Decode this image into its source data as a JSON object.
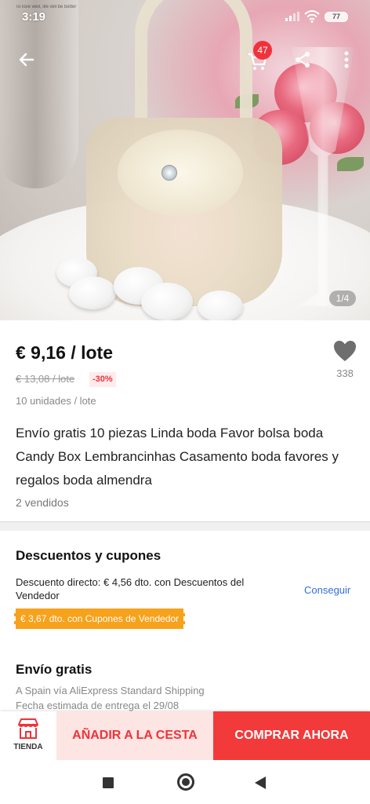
{
  "statusbar": {
    "brand": "To love well, life will be better",
    "time": "3:19",
    "battery": "77"
  },
  "topbar": {
    "back_icon": "arrow-left-icon",
    "cart_icon": "cart-icon",
    "cart_count": "47",
    "share_icon": "share-icon",
    "more_icon": "more-vertical-icon"
  },
  "gallery": {
    "counter": "1/4"
  },
  "product": {
    "price": "€ 9,16 / lote",
    "old_price": "€ 13,08 / lote",
    "discount": "-30%",
    "units": "10 unidades / lote",
    "title": "Envío gratis 10 piezas Linda boda Favor bolsa boda Candy Box Lembrancinhas Casamento boda favores y regalos boda almendra",
    "sold": "2 vendidos",
    "wishlist_count": "338"
  },
  "coupons": {
    "title": "Descuentos y cupones",
    "direct_discount": "Descuento directo: € 4,56 dto. con Descuentos del Vendedor",
    "get_label": "Conseguir",
    "seller_coupon": "€ 3,67 dto. con Cupones de Vendedor"
  },
  "shipping": {
    "title": "Envío gratis",
    "route": "A Spain vía AliExpress Standard Shipping",
    "estimate": "Fecha estimada de entrega el 29/08"
  },
  "actions": {
    "store_label": "TIENDA",
    "add_to_cart": "AÑADIR A LA CESTA",
    "buy_now": "COMPRAR AHORA"
  },
  "colors": {
    "accent": "#f0323b",
    "coupon": "#f7a21b",
    "link": "#2f6fd8"
  }
}
